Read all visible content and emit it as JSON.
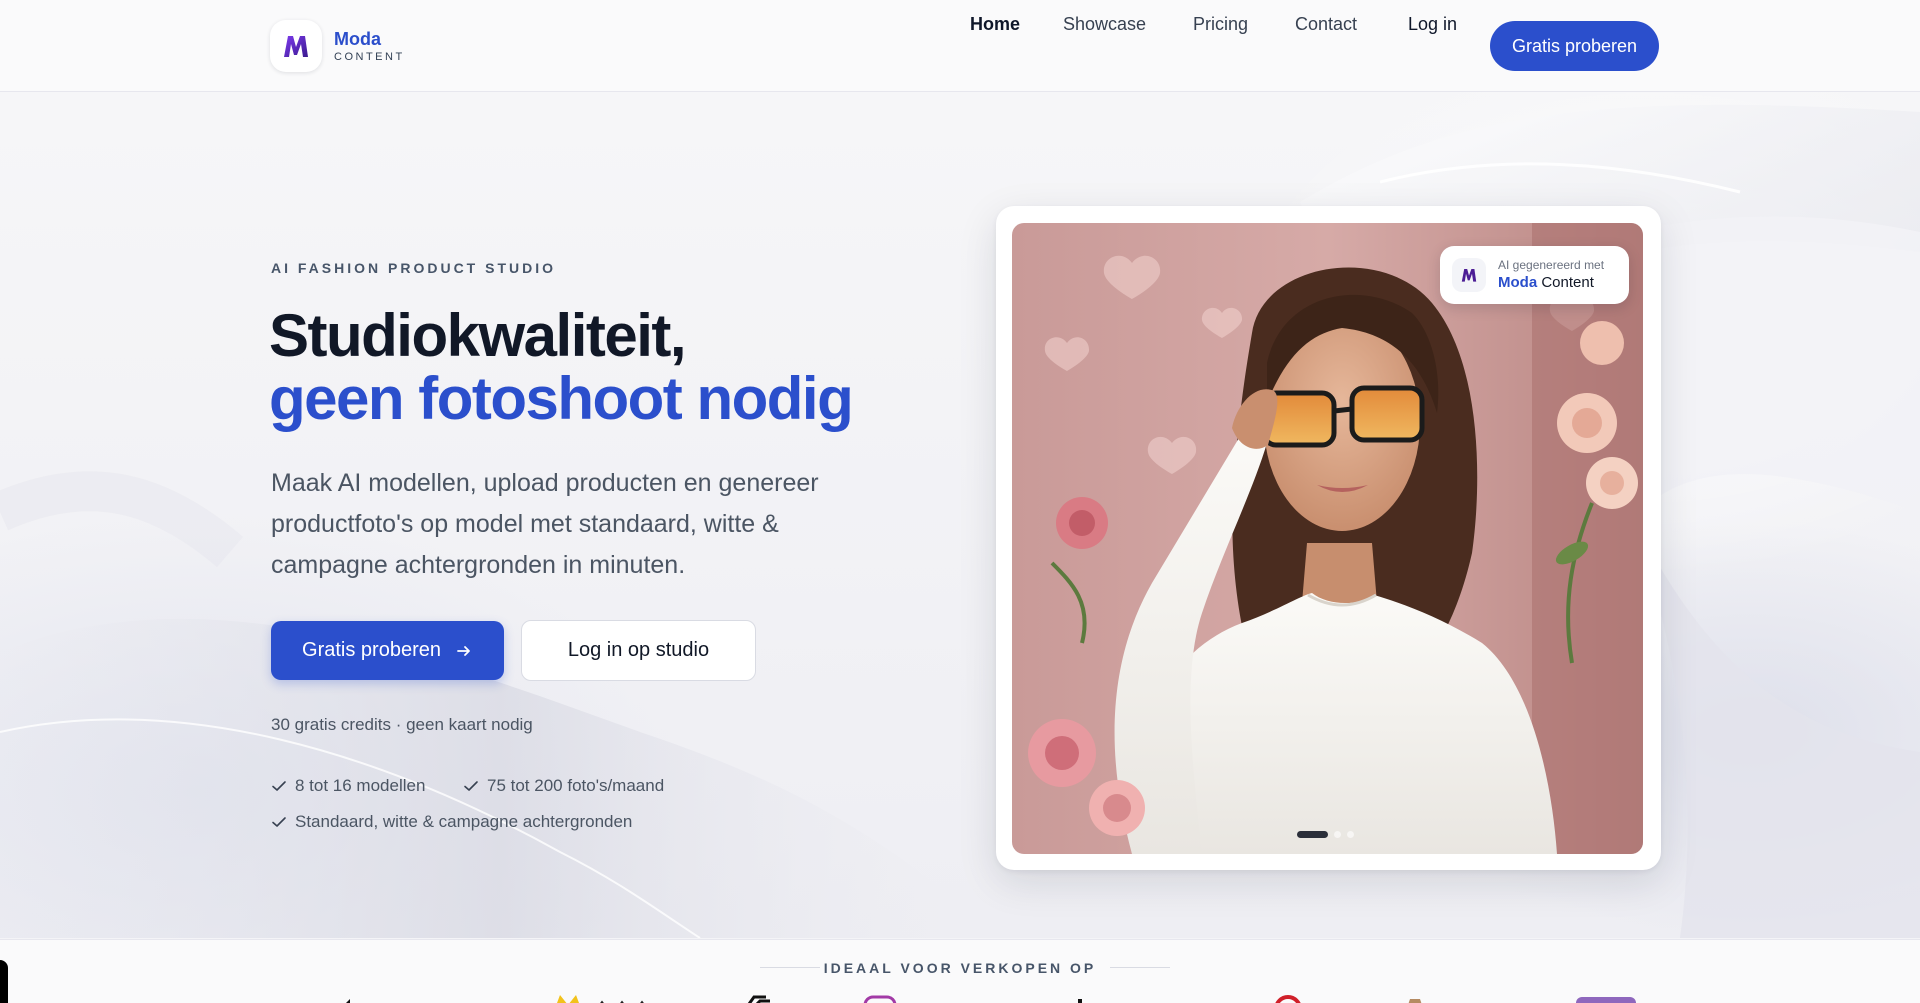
{
  "colors": {
    "brand_blue": "#2b4fcc",
    "heading_dark": "#111827",
    "text_gray": "#4b5563"
  },
  "header": {
    "logo": {
      "mark": "M",
      "name": "Moda",
      "sub": "CONTENT"
    },
    "nav": [
      {
        "label": "Home",
        "active": true
      },
      {
        "label": "Showcase"
      },
      {
        "label": "Pricing"
      },
      {
        "label": "Contact"
      },
      {
        "label": "Log in"
      }
    ],
    "cta": "Gratis proberen"
  },
  "hero": {
    "eyebrow": "AI FASHION PRODUCT STUDIO",
    "title_line1": "Studiokwaliteit,",
    "title_line2": "geen fotoshoot nodig",
    "lead": "Maak AI modellen, upload producten en genereer productfoto's op model met standaard, witte & campagne achtergronden in minuten.",
    "primary_button": "Gratis proberen",
    "primary_icon": "arrow-right-icon",
    "secondary_button": "Log in op studio",
    "note": "30 gratis credits · geen kaart nodig",
    "features": [
      "8 tot 16 modellen",
      "75 tot 200 foto's/maand",
      "Standaard, witte & campagne achtergronden"
    ]
  },
  "card": {
    "badge_line1": "AI gegenereerd met",
    "badge_brand": "Moda",
    "badge_suffix": "Content",
    "carousel": {
      "count": 3,
      "active": 1
    }
  },
  "strip": {
    "label": "IDEAAL VOOR VERKOPEN OP"
  }
}
